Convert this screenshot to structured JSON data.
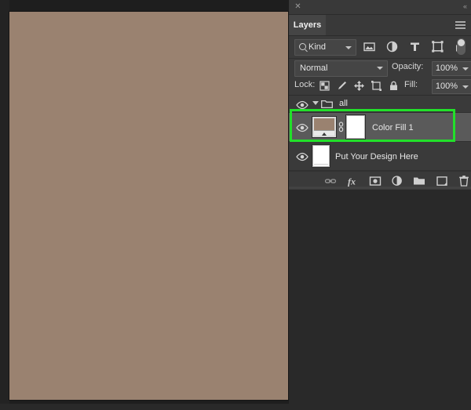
{
  "app": {
    "canvas_color": "#9a8270",
    "workspace_bg": "#292929",
    "panel_bg": "#3a3a3a",
    "selection_highlight_color": "#22e02a"
  },
  "document": {
    "name": "canvas-artboard",
    "fill_color": "#9a8270"
  },
  "panel": {
    "title": "Layers",
    "close_glyph": "✕",
    "collapse_glyph": "«",
    "menu_icon": "hamburger-menu-icon"
  },
  "filter_bar": {
    "kind_label": "Kind",
    "search_icon": "search-icon",
    "type_filters": [
      {
        "name": "filter-pixel-layers",
        "icon": "image-icon"
      },
      {
        "name": "filter-adjustment-layers",
        "icon": "half-circle-icon"
      },
      {
        "name": "filter-type-layers",
        "icon": "text-t-icon"
      },
      {
        "name": "filter-shape-layers",
        "icon": "shape-square-icon"
      },
      {
        "name": "filter-smart-objects",
        "icon": "smart-object-icon"
      }
    ],
    "toggle_name": "filter-enable-toggle"
  },
  "blend_row": {
    "blend_mode": "Normal",
    "opacity_label": "Opacity:",
    "opacity_value": "100%"
  },
  "lock_row": {
    "lock_label": "Lock:",
    "lock_buttons": [
      {
        "name": "lock-transparent-pixels",
        "icon": "checkerboard-icon"
      },
      {
        "name": "lock-image-pixels",
        "icon": "brush-icon"
      },
      {
        "name": "lock-position",
        "icon": "move-arrows-icon"
      },
      {
        "name": "lock-artboard-nesting",
        "icon": "artboard-icon"
      },
      {
        "name": "lock-all",
        "icon": "padlock-icon"
      }
    ],
    "fill_label": "Fill:",
    "fill_value": "100%"
  },
  "layers": [
    {
      "name": "all",
      "type": "group",
      "visible": true,
      "expanded": true,
      "selected": false,
      "indent": 0
    },
    {
      "name": "Color Fill 1",
      "type": "fill",
      "visible": true,
      "selected": true,
      "linked": true,
      "has_mask": true,
      "thumb_color": "#9a8270",
      "indent": 1
    },
    {
      "name": "Put Your Design Here",
      "type": "smart_object",
      "visible": true,
      "selected": false,
      "indent": 1
    }
  ],
  "footer_buttons": [
    {
      "name": "link-layers-button",
      "icon": "chain-link-icon"
    },
    {
      "name": "layer-style-button",
      "icon": "fx-icon"
    },
    {
      "name": "add-layer-mask-button",
      "icon": "mask-icon"
    },
    {
      "name": "new-adjustment-layer-button",
      "icon": "half-circle-icon"
    },
    {
      "name": "new-group-button",
      "icon": "folder-icon"
    },
    {
      "name": "new-layer-button",
      "icon": "new-layer-icon"
    },
    {
      "name": "delete-layer-button",
      "icon": "trash-icon"
    }
  ]
}
